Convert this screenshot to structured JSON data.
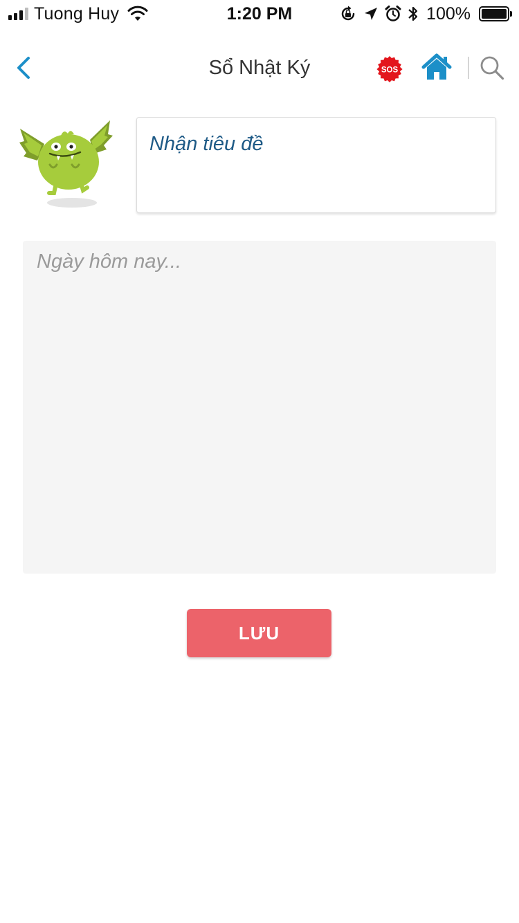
{
  "status_bar": {
    "carrier": "Tuong Huy",
    "time": "1:20 PM",
    "battery_percent_label": "100%",
    "battery_level": 1.0,
    "signal_bars_filled": 3,
    "signal_bars_total": 4,
    "icons": [
      "signal-icon",
      "wifi-icon",
      "orientation-lock-icon",
      "location-arrow-icon",
      "alarm-icon",
      "bluetooth-icon",
      "battery-icon"
    ]
  },
  "nav": {
    "title": "Sổ Nhật Ký",
    "back_icon": "chevron-left-icon",
    "sos_label": "SOS",
    "home_icon": "home-icon",
    "search_icon": "search-icon"
  },
  "form": {
    "title_placeholder": "Nhận tiêu đề",
    "title_value": "",
    "body_placeholder": "Ngày hôm nay...",
    "body_value": ""
  },
  "actions": {
    "save_label": "LƯU"
  },
  "colors": {
    "accent_blue": "#1c8fc8",
    "title_text": "#1e5a86",
    "sos_red": "#e3161d",
    "save_button": "#ec636a",
    "mascot_green": "#a6cc3c",
    "body_background": "#f5f5f5"
  }
}
